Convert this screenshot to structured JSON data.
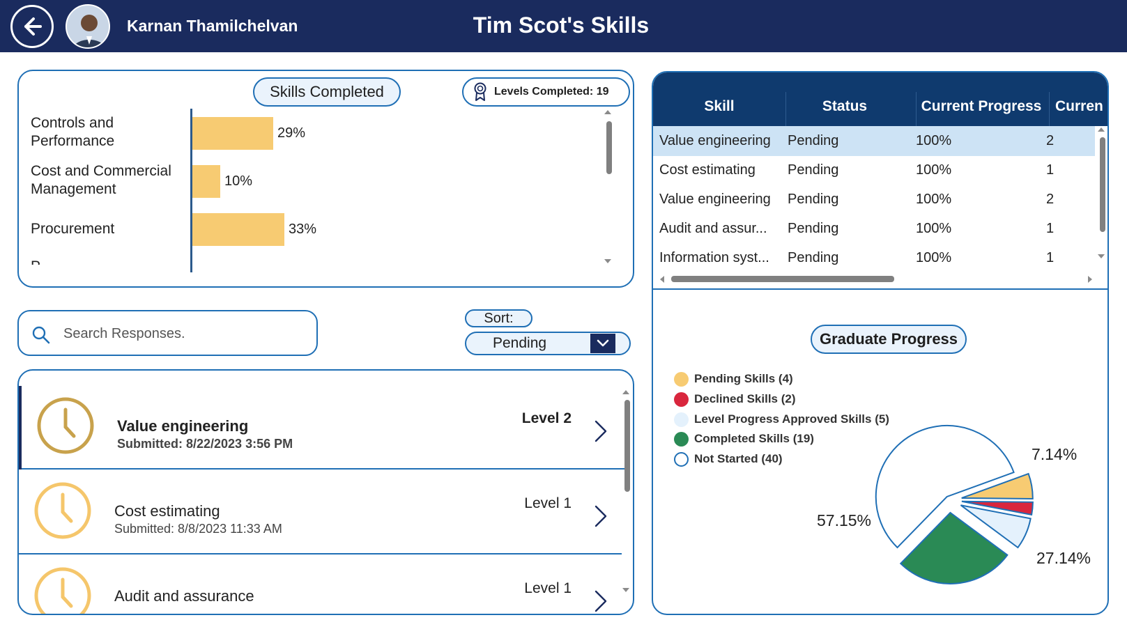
{
  "header": {
    "user_name": "Karnan Thamilchelvan",
    "title": "Tim Scot's Skills"
  },
  "skills_completed": {
    "title": "Skills Completed",
    "levels_label": "Levels Completed:",
    "levels_value": "19"
  },
  "chart_data": {
    "type": "bar",
    "orientation": "horizontal",
    "categories": [
      "Controls and Performance",
      "Cost and Commercial Management",
      "Procurement"
    ],
    "values": [
      29,
      10,
      33
    ],
    "value_labels": [
      "29%",
      "10%",
      "33%"
    ],
    "xlim": [
      0,
      100
    ],
    "color": "#f7cb72"
  },
  "search": {
    "placeholder": "Search Responses."
  },
  "sort": {
    "label": "Sort:",
    "value": "Pending"
  },
  "responses": [
    {
      "name": "Value engineering",
      "submitted": "Submitted: 8/22/2023 3:56 PM",
      "level": "Level 2"
    },
    {
      "name": "Cost estimating",
      "submitted": "Submitted: 8/8/2023 11:33 AM",
      "level": "Level 1"
    },
    {
      "name": "Audit and assurance",
      "submitted": "",
      "level": "Level 1"
    }
  ],
  "table": {
    "headers": [
      "Skill",
      "Status",
      "Current Progress",
      "Curren"
    ],
    "rows": [
      [
        "Value engineering",
        "Pending",
        "100%",
        "2"
      ],
      [
        "Cost estimating",
        "Pending",
        "100%",
        "1"
      ],
      [
        "Value engineering",
        "Pending",
        "100%",
        "2"
      ],
      [
        "Audit and assur...",
        "Pending",
        "100%",
        "1"
      ],
      [
        "Information syst...",
        "Pending",
        "100%",
        "1"
      ]
    ]
  },
  "graduate_progress": {
    "title": "Graduate Progress",
    "legend": [
      {
        "label": "Pending Skills (4)",
        "color": "#f7cb72",
        "filled": true
      },
      {
        "label": "Declined Skills (2)",
        "color": "#d9263d",
        "filled": true
      },
      {
        "label": "Level Progress Approved Skills (5)",
        "color": "#e4f1fc",
        "filled": true
      },
      {
        "label": "Completed Skills (19)",
        "color": "#2a8a55",
        "filled": true
      },
      {
        "label": "Not Started (40)",
        "color": "#ffffff",
        "filled": false
      }
    ],
    "pie": {
      "type": "pie",
      "values": [
        4,
        2,
        5,
        19,
        40
      ],
      "labels": [
        "7.14%",
        "27.14%",
        "57.15%"
      ],
      "colors": [
        "#f7cb72",
        "#d9263d",
        "#e4f1fc",
        "#2a8a55",
        "#ffffff"
      ],
      "stroke": "#1f6fb5"
    }
  }
}
